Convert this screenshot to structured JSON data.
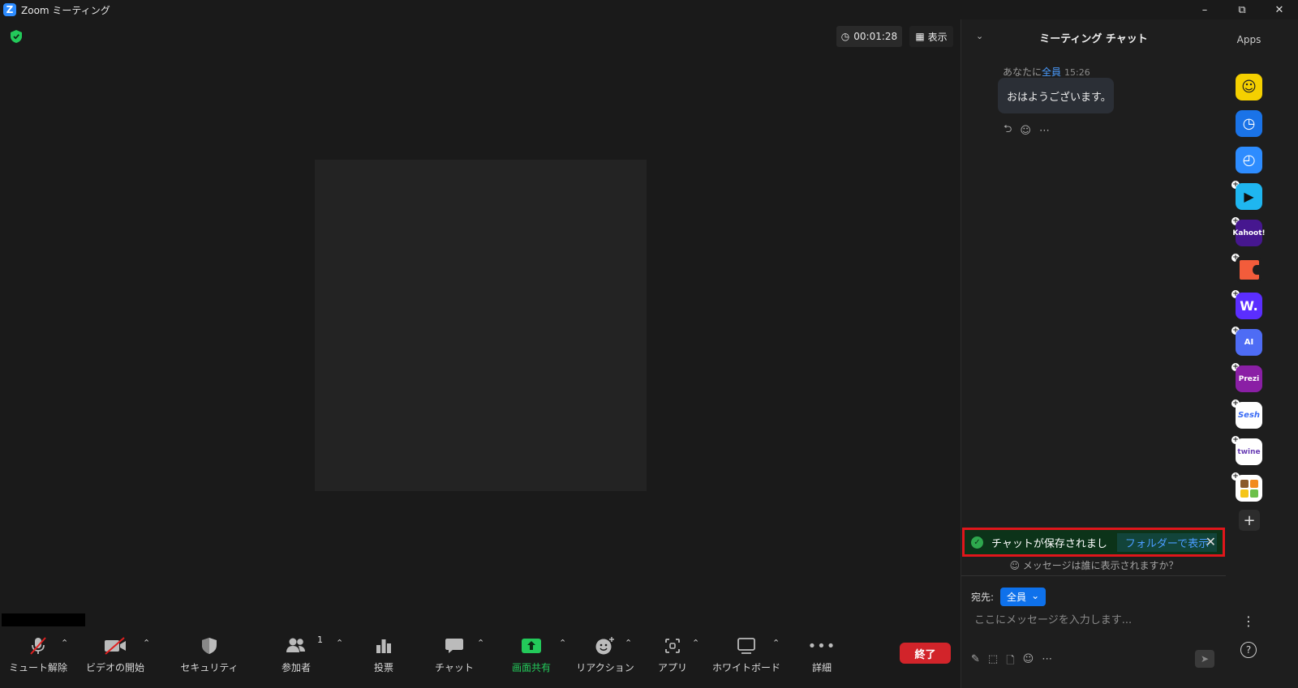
{
  "window": {
    "title": "Zoom ミーティング",
    "logo_letter": "Z"
  },
  "stage": {
    "timer": "00:01:28",
    "view_label": "表示"
  },
  "toolbar": {
    "mute": "ミュート解除",
    "video": "ビデオの開始",
    "security": "セキュリティ",
    "participants": "参加者",
    "participants_count": "1",
    "polls": "投票",
    "chat": "チャット",
    "share": "画面共有",
    "reactions": "リアクション",
    "apps": "アプリ",
    "whiteboard": "ホワイトボード",
    "more": "詳細",
    "end": "終了"
  },
  "chat": {
    "title": "ミーティング チャット",
    "message": {
      "from": "あなたに",
      "to": "全員",
      "time": "15:26",
      "text": "おはようございます。"
    },
    "toast": {
      "text": "チャットが保存されまし",
      "link": "フォルダーで表示"
    },
    "who_can_see": "メッセージは誰に表示されますか？",
    "recipient_label": "宛先:",
    "recipient_value": "全員",
    "placeholder": "ここにメッセージを入力します..."
  },
  "rail": {
    "title": "Apps",
    "apps": [
      {
        "name": "Emoji",
        "label": "",
        "color": "#f5d000"
      },
      {
        "name": "Timer",
        "label": "",
        "color": "#1a73e8"
      },
      {
        "name": "Stopwatch",
        "label": "",
        "color": "#2d8cff"
      },
      {
        "name": "Flip",
        "label": "",
        "color": "#1fb6f0"
      },
      {
        "name": "Kahoot",
        "label": "Kahoot!",
        "color": "#46178f"
      },
      {
        "name": "Coda",
        "label": "",
        "color": "#f25c3b"
      },
      {
        "name": "Wooclap",
        "label": "W.",
        "color": "#5b2eff"
      },
      {
        "name": "AI Companion",
        "label": "AI",
        "color": "#4e6cf5"
      },
      {
        "name": "Prezi",
        "label": "Prezi",
        "color": "#8a1fa5"
      },
      {
        "name": "Sesh",
        "label": "Sesh",
        "color": "#ffffff"
      },
      {
        "name": "Twine",
        "label": "twine",
        "color": "#ffffff"
      },
      {
        "name": "Blocks",
        "label": "",
        "color": "#ffffff"
      }
    ]
  }
}
